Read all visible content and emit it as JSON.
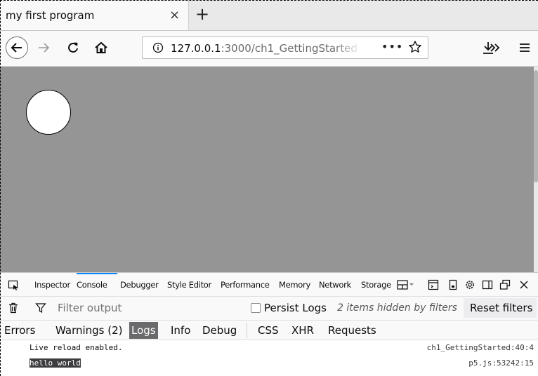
{
  "browser": {
    "tab_title": "my first program",
    "tab_close": "×",
    "new_tab": "+",
    "url_host": "127.0.0.1",
    "url_rest": ":3000/ch1_GettingStarted",
    "url_more": "•••"
  },
  "devtools": {
    "tabs": [
      "Inspector",
      "Console",
      "Debugger",
      "Style Editor",
      "Performance",
      "Memory",
      "Network",
      "Storage"
    ],
    "selected_tab": "Console",
    "filter_placeholder": "Filter output",
    "persist_logs": "Persist Logs",
    "hidden_note": "2 items hidden by filters",
    "reset_filters": "Reset filters",
    "categories": [
      "Errors",
      "Warnings (2)",
      "Logs",
      "Info",
      "Debug",
      "CSS",
      "XHR",
      "Requests"
    ],
    "active_category": "Logs",
    "messages": [
      {
        "text": "Live reload enabled.",
        "location": "ch1_GettingStarted:40:4"
      },
      {
        "text": "hello world",
        "location": "p5.js:53242:15"
      }
    ]
  },
  "colors": {
    "canvas_bg": "#959595",
    "circle_fill": "#ffffff",
    "accent": "#0a84ff",
    "active_filter_bg": "#6a6a6c"
  }
}
